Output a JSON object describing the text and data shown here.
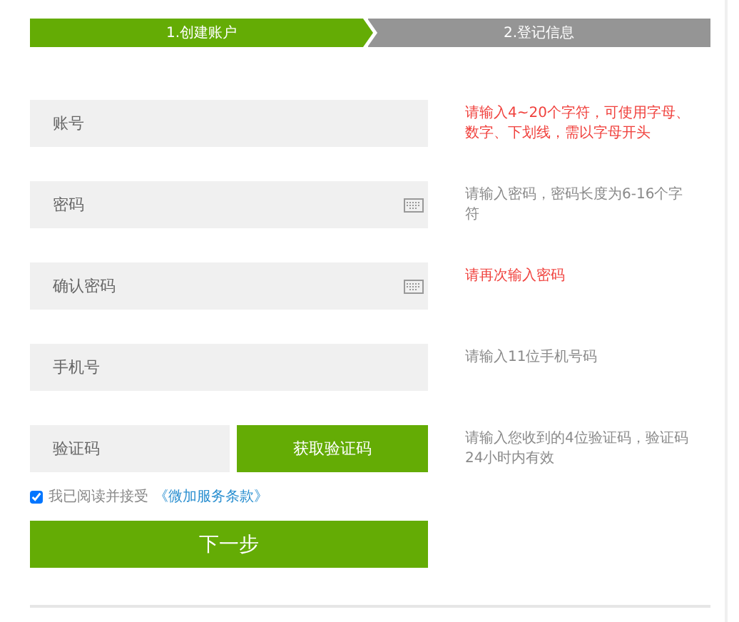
{
  "steps": [
    {
      "label": "1.创建账户",
      "selected": true
    },
    {
      "label": "2.登记信息",
      "selected": false
    }
  ],
  "fields": [
    {
      "kind": "text",
      "placeholder": "账号",
      "keyboard": false,
      "hint": "请输入4~20个字符，可使用字母、数字、下划线，需以字母开头",
      "hint_error": true
    },
    {
      "kind": "text",
      "placeholder": "密码",
      "keyboard": true,
      "hint": "请输入密码，密码长度为6-16个字符",
      "hint_error": false
    },
    {
      "kind": "text",
      "placeholder": "确认密码",
      "keyboard": true,
      "hint": "请再次输入密码",
      "hint_error": true
    },
    {
      "kind": "text",
      "placeholder": "手机号",
      "keyboard": false,
      "hint": "请输入11位手机号码",
      "hint_error": false
    },
    {
      "kind": "captcha",
      "placeholder": "验证码",
      "button": "获取验证码",
      "hint": "请输入您收到的4位验证码，验证码24小时内有效",
      "hint_error": false
    }
  ],
  "agreement": {
    "checked": true,
    "text": "我已阅读并接受",
    "link": "《微加服务条款》"
  },
  "submit": "下一步"
}
